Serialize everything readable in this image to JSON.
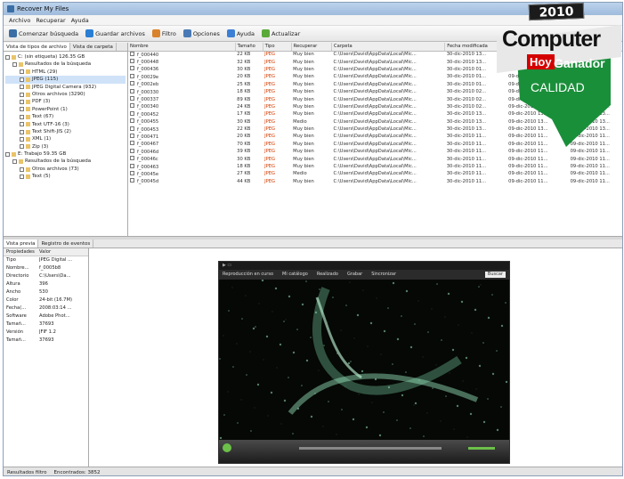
{
  "window": {
    "title": "Recover My Files"
  },
  "menu": [
    "Archivo",
    "Recuperar",
    "Ayuda"
  ],
  "toolbar": [
    {
      "label": "Comenzar búsqueda",
      "icon": "search-icon",
      "color": "#3a6ea5"
    },
    {
      "label": "Guardar archivos",
      "icon": "save-icon",
      "color": "#2a7fd4"
    },
    {
      "label": "Filtro",
      "icon": "filter-icon",
      "color": "#d9822b"
    },
    {
      "label": "Opciones",
      "icon": "options-icon",
      "color": "#4a7ab5"
    },
    {
      "label": "Ayuda",
      "icon": "help-icon",
      "color": "#3c7fd6"
    },
    {
      "label": "Actualizar",
      "icon": "refresh-icon",
      "color": "#5aaa3a"
    }
  ],
  "left_tabs": [
    "Vista de tipos de archivo",
    "Vista de carpeta"
  ],
  "tree": [
    "C: (sin etiqueta) 126.35 GB",
    "Resultados de la búsqueda",
    "HTML (29)",
    "JPEG (115)",
    "JPEG Digital Camera (932)",
    "Otros archivos (3290)",
    "PDF (3)",
    "PowerPoint (1)",
    "Text (67)",
    "Text UTF-16 (3)",
    "Text Shift-JIS (2)",
    "XML (1)",
    "Zip (3)",
    "E: Trabajo 59.35 GB",
    "Resultados de la búsqueda",
    "Otros archivos (73)",
    "Text (5)"
  ],
  "table": {
    "columns": [
      "Nombre",
      "Tamaño",
      "Tipo",
      "Recuperar",
      "Carpeta",
      "Fecha modificada",
      "Fecha creada",
      "Fecha"
    ],
    "rows": [
      [
        "f_000440",
        "22 KB",
        "JPEG",
        "Muy bien",
        "C:\\Users\\David\\AppData\\Local\\Mic...",
        "30-dic-2010 13...",
        "09-dic-2010 13...",
        "01-dic"
      ],
      [
        "f_000448",
        "32 KB",
        "JPEG",
        "Muy bien",
        "C:\\Users\\David\\AppData\\Local\\Mic...",
        "30-dic-2010 13...",
        "09-dic-2010 13...",
        "01-dic"
      ],
      [
        "f_000436",
        "30 KB",
        "JPEG",
        "Muy bien",
        "C:\\Users\\David\\AppData\\Local\\Mic...",
        "30-dic-2010 01...",
        "09-dic-2010 01...",
        "02-dic"
      ],
      [
        "f_00029e",
        "20 KB",
        "JPEG",
        "Muy bien",
        "C:\\Users\\David\\AppData\\Local\\Mic...",
        "30-dic-2010 01...",
        "09-dic-2010 01...",
        "02-dic"
      ],
      [
        "f_0002eb",
        "25 KB",
        "JPEG",
        "Muy bien",
        "C:\\Users\\David\\AppData\\Local\\Mic...",
        "30-dic-2010 01...",
        "09-dic-2010 01...",
        "02-dic"
      ],
      [
        "f_000330",
        "18 KB",
        "JPEG",
        "Muy bien",
        "C:\\Users\\David\\AppData\\Local\\Mic...",
        "30-dic-2010 02...",
        "09-dic-2010 02...",
        "02-dic"
      ],
      [
        "f_000337",
        "89 KB",
        "JPEG",
        "Muy bien",
        "C:\\Users\\David\\AppData\\Local\\Mic...",
        "30-dic-2010 02...",
        "09-dic-2010 02...",
        "02-dic"
      ],
      [
        "f_000340",
        "24 KB",
        "JPEG",
        "Muy bien",
        "C:\\Users\\David\\AppData\\Local\\Mic...",
        "30-dic-2010 02...",
        "09-dic-2010 02...",
        "02-dic-2010 02..."
      ],
      [
        "f_000452",
        "17 KB",
        "JPEG",
        "Muy bien",
        "C:\\Users\\David\\AppData\\Local\\Mic...",
        "30-dic-2010 13...",
        "09-dic-2010 13...",
        "01-dic-2010 13..."
      ],
      [
        "f_000455",
        "30 KB",
        "JPEG",
        "Medio",
        "C:\\Users\\David\\AppData\\Local\\Mic...",
        "30-dic-2010 13...",
        "09-dic-2010 13...",
        "09-dic-2010 13..."
      ],
      [
        "f_000453",
        "22 KB",
        "JPEG",
        "Muy bien",
        "C:\\Users\\David\\AppData\\Local\\Mic...",
        "30-dic-2010 13...",
        "09-dic-2010 13...",
        "09-dic-2010 13..."
      ],
      [
        "f_000471",
        "20 KB",
        "JPEG",
        "Muy bien",
        "C:\\Users\\David\\AppData\\Local\\Mic...",
        "30-dic-2010 11...",
        "09-dic-2010 11...",
        "09-dic-2010 11..."
      ],
      [
        "f_000467",
        "70 KB",
        "JPEG",
        "Muy bien",
        "C:\\Users\\David\\AppData\\Local\\Mic...",
        "30-dic-2010 11...",
        "09-dic-2010 11...",
        "09-dic-2010 11..."
      ],
      [
        "f_00046d",
        "39 KB",
        "JPEG",
        "Muy bien",
        "C:\\Users\\David\\AppData\\Local\\Mic...",
        "30-dic-2010 11...",
        "09-dic-2010 11...",
        "09-dic-2010 11..."
      ],
      [
        "f_00046c",
        "30 KB",
        "JPEG",
        "Muy bien",
        "C:\\Users\\David\\AppData\\Local\\Mic...",
        "30-dic-2010 11...",
        "09-dic-2010 11...",
        "09-dic-2010 11..."
      ],
      [
        "f_000463",
        "18 KB",
        "JPEG",
        "Muy bien",
        "C:\\Users\\David\\AppData\\Local\\Mic...",
        "30-dic-2010 11...",
        "09-dic-2010 11...",
        "09-dic-2010 11..."
      ],
      [
        "f_00045e",
        "27 KB",
        "JPEG",
        "Medio",
        "C:\\Users\\David\\AppData\\Local\\Mic...",
        "30-dic-2010 11...",
        "09-dic-2010 11...",
        "09-dic-2010 11..."
      ],
      [
        "f_00045d",
        "44 KB",
        "JPEG",
        "Muy bien",
        "C:\\Users\\David\\AppData\\Local\\Mic...",
        "30-dic-2010 11...",
        "09-dic-2010 11...",
        "09-dic-2010 11..."
      ]
    ]
  },
  "bottom_tabs": [
    "Vista previa",
    "Registro de eventos"
  ],
  "properties": {
    "headers": [
      "Propiedades",
      "Valor"
    ],
    "rows": [
      [
        "Tipo",
        "JPEG Digital ..."
      ],
      [
        "Nombre...",
        "f_0005b8"
      ],
      [
        "Directorio",
        "C:\\Users\\Da..."
      ],
      [
        "Altura",
        "396"
      ],
      [
        "Ancho",
        "530"
      ],
      [
        "Color",
        "24-bit (16.7M)"
      ],
      [
        "Fecha(...",
        "2008:03:14 ..."
      ],
      [
        "Software",
        "Adobe Phot..."
      ],
      [
        "Tamañ...",
        "37693"
      ],
      [
        "Versión",
        "JFIF 1.2"
      ],
      [
        "Tamañ...",
        "37693"
      ]
    ]
  },
  "player": {
    "nav": [
      "Reproducción en curso",
      "Mi catálogo",
      "Realizado",
      "Grabar",
      "Sincronizar"
    ],
    "search": "Buscar"
  },
  "status": [
    "Resultados filtro",
    "Encontrados: 3852"
  ],
  "badge": {
    "year": "2010",
    "brand": "Computer",
    "hoy": "Hoy",
    "winner": "Ganador",
    "quality": "CALIDAD",
    "color": "#1a8f3a"
  }
}
